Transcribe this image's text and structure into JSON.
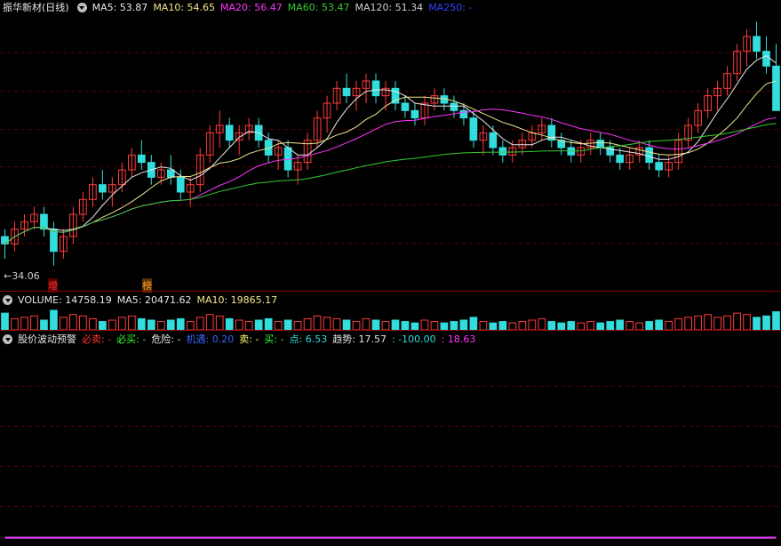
{
  "colors": {
    "ma5": "#e8e8e8",
    "ma10": "#f0e68c",
    "ma20": "#ff33ff",
    "ma60": "#33cc33",
    "ma120": "#d0d0d0",
    "ma250": "#3344ff",
    "up": "#ff3b3b",
    "down": "#33dddd",
    "divider": "#8b0000",
    "grid": "#5a0000",
    "cyan": "#33e5f0",
    "magenta": "#ee33ee",
    "white": "#e6e6e6",
    "label_red": "#ff3333",
    "label_green": "#33ff33",
    "label_blue": "#3366ff",
    "label_yellow": "#ffff66"
  },
  "main_header": {
    "title": "振华新材(日线)",
    "ma5": "MA5: 53.87",
    "ma10": "MA10: 54.65",
    "ma20": "MA20: 56.47",
    "ma60": "MA60: 53.47",
    "ma120": "MA120: 51.34",
    "ma250": "MA250: -"
  },
  "low_price_label": "34.06",
  "tag_zeng": "增",
  "tag_bang": "榜",
  "volume_header": {
    "volume": "VOLUME: 14758.19",
    "ma5": "MA5: 20471.62",
    "ma10": "MA10: 19865.17"
  },
  "indicator_header": {
    "name": "股价波动预警",
    "bimai": "必卖: -",
    "bimai2": "必买: -",
    "danger": "危险: -",
    "jiyu": "机遇: 0.20",
    "sell": "卖: -",
    "buy": "买: -",
    "point": "点: 6.53",
    "trend": "趋势: 17.57",
    "v1": ": -100.00",
    "v2": ": 18.63"
  },
  "chart_data": {
    "type": "candlestick",
    "candles": [
      [
        38,
        39,
        35,
        37
      ],
      [
        37,
        40,
        36,
        39
      ],
      [
        39,
        41,
        38,
        40
      ],
      [
        40,
        42,
        39,
        41
      ],
      [
        41,
        42,
        38,
        39
      ],
      [
        39,
        40,
        34.06,
        36
      ],
      [
        36,
        39,
        35,
        38
      ],
      [
        38,
        42,
        37,
        41
      ],
      [
        41,
        44,
        40,
        43
      ],
      [
        43,
        46,
        42,
        45
      ],
      [
        45,
        47,
        43,
        44
      ],
      [
        44,
        46,
        42,
        45
      ],
      [
        45,
        48,
        44,
        47
      ],
      [
        47,
        50,
        46,
        49
      ],
      [
        49,
        51,
        47,
        48
      ],
      [
        48,
        49,
        45,
        46
      ],
      [
        46,
        48,
        45,
        47
      ],
      [
        47,
        49,
        45,
        46
      ],
      [
        46,
        47,
        43,
        44
      ],
      [
        44,
        46,
        42,
        45
      ],
      [
        45,
        50,
        44,
        49
      ],
      [
        49,
        53,
        48,
        52
      ],
      [
        52,
        55,
        50,
        53
      ],
      [
        53,
        54,
        50,
        51
      ],
      [
        51,
        53,
        49,
        52
      ],
      [
        52,
        54,
        51,
        53
      ],
      [
        53,
        54,
        50,
        51
      ],
      [
        51,
        52,
        48,
        49
      ],
      [
        49,
        51,
        47,
        50
      ],
      [
        50,
        51,
        46,
        47
      ],
      [
        47,
        49,
        45,
        48
      ],
      [
        48,
        52,
        47,
        51
      ],
      [
        51,
        55,
        50,
        54
      ],
      [
        54,
        57,
        52,
        56
      ],
      [
        56,
        59,
        55,
        58
      ],
      [
        58,
        60,
        56,
        57
      ],
      [
        57,
        59,
        55,
        58
      ],
      [
        58,
        60,
        56,
        59
      ],
      [
        59,
        60,
        56,
        57
      ],
      [
        57,
        59,
        55,
        58
      ],
      [
        58,
        59,
        55,
        56
      ],
      [
        56,
        57,
        54,
        55
      ],
      [
        55,
        56,
        53,
        54
      ],
      [
        54,
        57,
        53,
        56
      ],
      [
        56,
        58,
        55,
        57
      ],
      [
        57,
        58,
        55,
        56
      ],
      [
        56,
        57,
        54,
        55
      ],
      [
        55,
        56,
        53,
        54
      ],
      [
        54,
        55,
        50,
        51
      ],
      [
        51,
        53,
        49,
        52
      ],
      [
        52,
        53,
        49,
        50
      ],
      [
        50,
        51,
        48,
        49
      ],
      [
        49,
        51,
        48,
        50
      ],
      [
        50,
        52,
        49,
        51
      ],
      [
        51,
        53,
        50,
        52
      ],
      [
        52,
        54,
        51,
        53
      ],
      [
        53,
        54,
        50,
        51
      ],
      [
        51,
        52,
        49,
        50
      ],
      [
        50,
        51,
        48,
        49
      ],
      [
        49,
        51,
        48,
        50
      ],
      [
        50,
        52,
        49,
        51
      ],
      [
        51,
        52,
        49,
        50
      ],
      [
        50,
        51,
        48,
        49
      ],
      [
        49,
        50,
        47,
        48
      ],
      [
        48,
        50,
        47,
        49
      ],
      [
        49,
        51,
        48,
        50
      ],
      [
        50,
        51,
        47,
        48
      ],
      [
        48,
        49,
        46,
        47
      ],
      [
        47,
        49,
        46,
        48
      ],
      [
        48,
        52,
        47,
        51
      ],
      [
        51,
        54,
        50,
        53
      ],
      [
        53,
        56,
        52,
        55
      ],
      [
        55,
        58,
        54,
        57
      ],
      [
        57,
        59,
        55,
        58
      ],
      [
        58,
        61,
        57,
        60
      ],
      [
        60,
        64,
        59,
        63
      ],
      [
        63,
        66,
        61,
        65
      ],
      [
        65,
        67,
        62,
        63
      ],
      [
        63,
        65,
        60,
        61
      ],
      [
        61,
        64,
        58,
        55
      ]
    ],
    "ylim": [
      32,
      68
    ],
    "volume": [
      1.2,
      0.8,
      0.9,
      1.0,
      0.7,
      1.4,
      0.9,
      1.1,
      1.0,
      0.8,
      0.6,
      0.7,
      0.9,
      1.0,
      0.8,
      0.7,
      0.6,
      0.7,
      0.8,
      0.6,
      0.9,
      1.1,
      1.0,
      0.8,
      0.7,
      0.6,
      0.7,
      0.8,
      0.6,
      0.7,
      0.6,
      0.8,
      1.0,
      0.9,
      0.8,
      0.7,
      0.6,
      0.8,
      0.7,
      0.6,
      0.7,
      0.6,
      0.5,
      0.7,
      0.6,
      0.5,
      0.6,
      0.7,
      0.9,
      0.6,
      0.5,
      0.6,
      0.5,
      0.6,
      0.7,
      0.8,
      0.6,
      0.5,
      0.6,
      0.5,
      0.6,
      0.5,
      0.6,
      0.7,
      0.6,
      0.5,
      0.6,
      0.7,
      0.6,
      0.8,
      0.9,
      1.0,
      1.1,
      0.9,
      1.0,
      1.2,
      1.1,
      0.9,
      1.0,
      1.3
    ],
    "indicator": {
      "ylim": [
        -110,
        130
      ],
      "cyan": [
        -100,
        -100,
        -100,
        -100,
        -100,
        -100,
        -100,
        -100,
        -100,
        -100,
        -100,
        -100,
        -100,
        -100,
        -100,
        -100,
        -100,
        -100,
        -100,
        -100,
        -100,
        -100,
        -100,
        -100,
        -100,
        -100,
        -100,
        -100,
        -100,
        -100,
        -100,
        -100,
        -100,
        -100,
        -100,
        -100,
        -100,
        -100,
        -100,
        -100,
        -100,
        -100,
        -100,
        -100,
        -100,
        -100,
        -100,
        -100,
        -100,
        -100,
        -100,
        -100,
        -100,
        -100,
        -100,
        -100,
        -100,
        -100,
        -100,
        -100,
        -100,
        -100,
        -100,
        -100,
        -100,
        -100,
        -100,
        -100,
        -100,
        -100,
        -100,
        -100,
        -100,
        -100,
        -100,
        -100,
        -100,
        -100,
        -100,
        -100
      ],
      "magenta": [
        -100,
        -100,
        -100,
        -100,
        -100,
        -100,
        -100,
        -100,
        -100,
        -100,
        -100,
        -100,
        -100,
        -100,
        -100,
        -100,
        -100,
        -100,
        -100,
        -100,
        -100,
        -100,
        -100,
        -100,
        -100,
        -100,
        -100,
        -100,
        -100,
        -100,
        -100,
        -100,
        -100,
        -100,
        -100,
        -100,
        -100,
        -100,
        -100,
        -100,
        -100,
        -100,
        -100,
        -100,
        -100,
        -100,
        -100,
        -100,
        -100,
        -100,
        -100,
        -100,
        -100,
        -100,
        -100,
        -100,
        -100,
        -100,
        -100,
        -100,
        -100,
        -100,
        -100,
        -100,
        -100,
        -100,
        -100,
        -100,
        -100,
        -100,
        -100,
        -100,
        -100,
        -100,
        -100,
        -100,
        -100,
        -100,
        -100,
        -100
      ]
    }
  }
}
